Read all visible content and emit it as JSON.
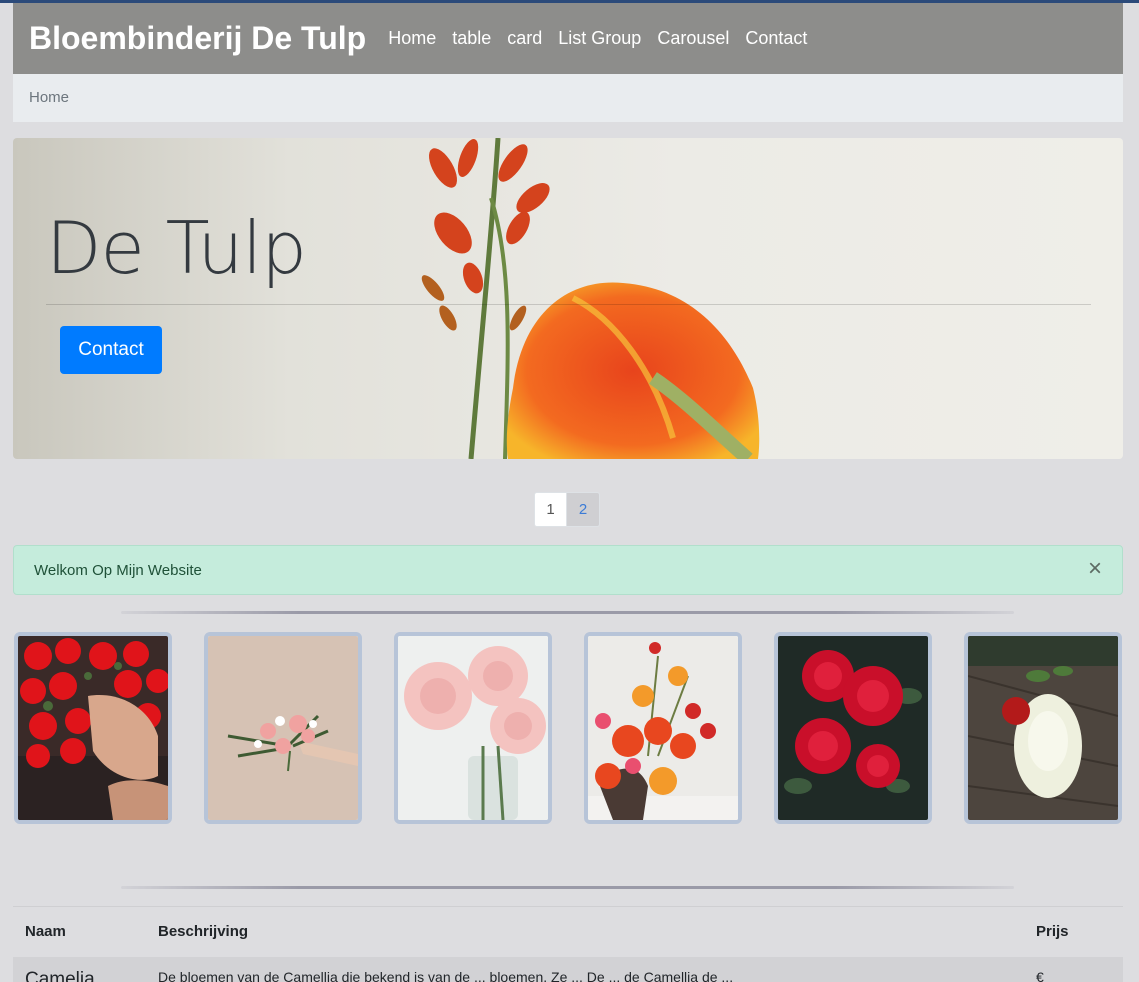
{
  "navbar": {
    "brand": "Bloembinderij De Tulp",
    "links": [
      "Home",
      "table",
      "card",
      "List Group",
      "Carousel",
      "Contact"
    ]
  },
  "breadcrumb": {
    "current": "Home"
  },
  "hero": {
    "title": "De Tulp",
    "button_label": "Contact"
  },
  "pagination": {
    "pages": [
      "1",
      "2"
    ]
  },
  "alert": {
    "message": "Welkom Op Mijn Website",
    "close_symbol": "×"
  },
  "gallery": {
    "images": [
      "red-roses-bouquet",
      "pink-white-bouquet",
      "pink-roses-vase",
      "orange-floral-arrangement",
      "red-roses-bush",
      "white-rose-on-wood"
    ]
  },
  "table": {
    "headers": [
      "Naam",
      "Beschrijving",
      "Prijs"
    ],
    "rows": [
      {
        "name": "Camelia",
        "description": "De bloemen van de Camellia die bekend is van de ... bloemen. Ze ... De ... de Camellia de ...",
        "price": "€"
      }
    ]
  },
  "colors": {
    "navbar": "#8d8d8b",
    "primary": "#007bff",
    "alert_bg": "#c5ecdc",
    "page_bg": "#dddde0"
  }
}
